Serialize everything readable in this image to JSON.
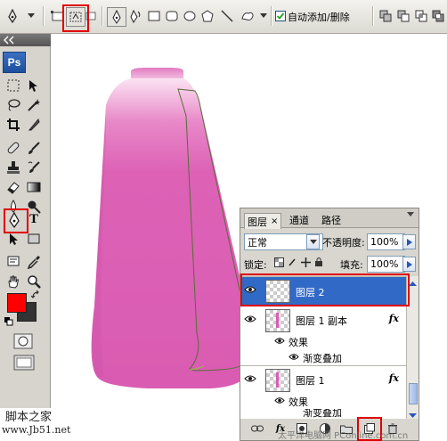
{
  "options_bar": {
    "auto_add_delete_label": "自动添加/删除",
    "auto_add_delete_checked": true
  },
  "toolbox": {
    "logo": "Ps",
    "text_tool_glyph": "T",
    "foreground_color": "#ff0000",
    "background_color": "#333333"
  },
  "layers_panel": {
    "tabs": [
      "图层",
      "通道",
      "路径"
    ],
    "blend_mode": "正常",
    "opacity_label": "不透明度:",
    "opacity_value": "100%",
    "lock_label": "锁定:",
    "fill_label": "填充:",
    "fill_value": "100%",
    "layers": [
      {
        "name": "图层 2",
        "selected": true,
        "has_fx": false
      },
      {
        "name": "图层 1 副本",
        "selected": false,
        "has_fx": true,
        "fx_label": "fx",
        "effects_label": "效果",
        "effect": "渐变叠加"
      },
      {
        "name": "图层 1",
        "selected": false,
        "has_fx": true,
        "fx_label": "fx",
        "effects_label": "效果",
        "effect": "渐变叠加"
      }
    ]
  },
  "watermark": {
    "left_title": "脚本之家",
    "left_url": "www.Jb51.net",
    "right_text": "太平洋电脑网 PConline.com.cn"
  },
  "colors": {
    "vase_pink": "#dc5fb4",
    "selected_row": "#3169c6",
    "highlight": "#e00000"
  }
}
